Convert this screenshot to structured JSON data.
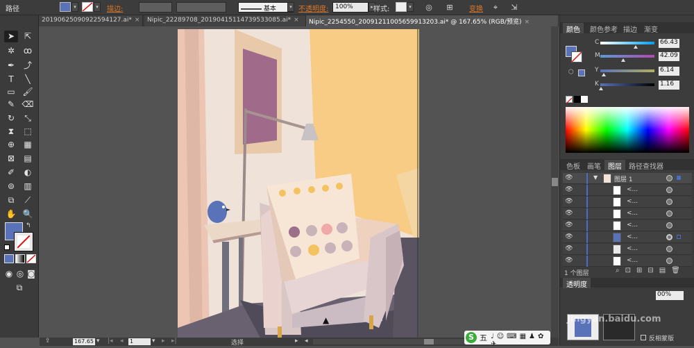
{
  "control_bar": {
    "object_type": "路径",
    "stroke_label": "描边:",
    "stroke_style": "基本",
    "opacity_label": "不透明度:",
    "opacity_value": "100%",
    "style_label": "样式:",
    "transform_label": "变换",
    "fill_color": "#5a72b8"
  },
  "tabs": [
    {
      "label": "20190625090922594127.ai*",
      "active": false
    },
    {
      "label": "Nipic_22289708_20190415114739533085.ai*",
      "active": false
    },
    {
      "label": "Nipic_2254550_20091211005659913203.ai* @ 167.65% (RGB/预览)",
      "active": true
    }
  ],
  "color_panel": {
    "tabs": [
      "颜色",
      "颜色参考",
      "描边",
      "渐变"
    ],
    "c_label": "C",
    "c_value": "66.43",
    "m_label": "M",
    "m_value": "42.09",
    "y_label": "Y",
    "y_value": "6.14",
    "k_label": "K",
    "k_value": "1.16",
    "c_pos": 0.66,
    "m_pos": 0.42,
    "y_pos": 0.06,
    "k_pos": 0.01
  },
  "layers_panel": {
    "tabs": [
      "色板",
      "画笔",
      "图层",
      "路径查找器"
    ],
    "layer_name": "图层 1",
    "sublayers": [
      "<...",
      "<...",
      "<...",
      "<...",
      "<...",
      "<...",
      "<..."
    ],
    "count_label": "1 个图层"
  },
  "transparency_panel": {
    "title": "透明度",
    "opacity_value": "00%",
    "invert_mask_label": "反相蒙版"
  },
  "status_bar": {
    "zoom": "167.65",
    "page": "1",
    "tool_status": "选择"
  },
  "ime_bar": {
    "mode": "五"
  },
  "watermark": "Jingyan.baidu.com"
}
